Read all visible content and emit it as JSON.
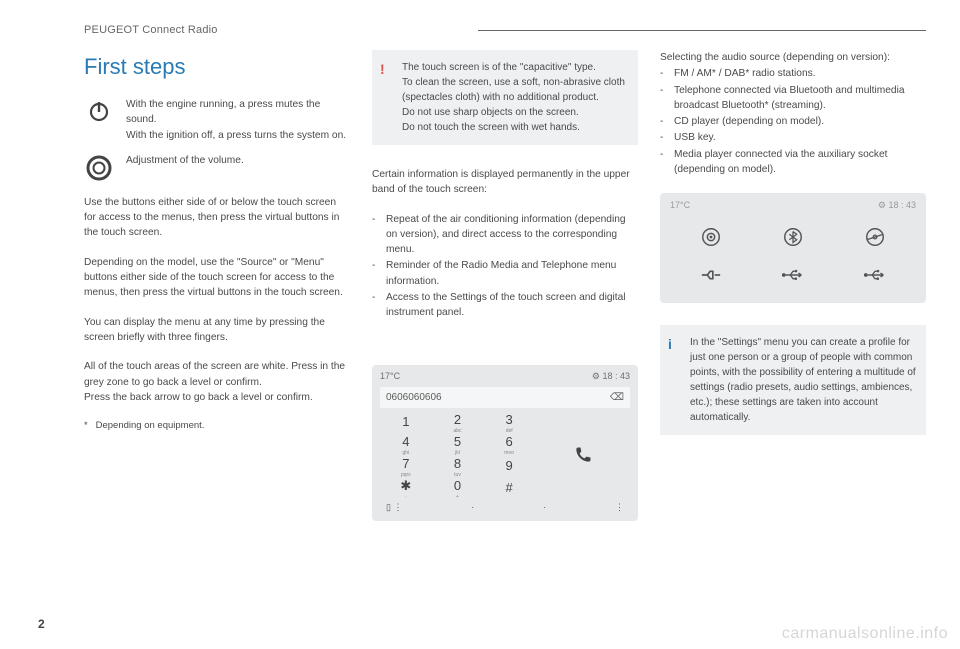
{
  "page_number": "2",
  "header": "PEUGEOT Connect Radio",
  "title": "First steps",
  "power_text": "With the engine running, a press mutes the sound.\nWith the ignition off, a press turns the system on.",
  "volume_text": "Adjustment of the volume.",
  "col1_p1": "Use the buttons either side of or below the touch screen for access to the menus, then press the virtual buttons in the touch screen.",
  "col1_p2": "Depending on the model, use the \"Source\" or \"Menu\" buttons either side of the touch screen for access to the menus, then press the virtual buttons in the touch screen.",
  "col1_p3": "You can display the menu at any time by pressing the screen briefly with three fingers.",
  "col1_p4": "All of the touch areas of the screen are white. Press in the grey zone to go back a level or confirm.\nPress the back arrow to go back a level or confirm.",
  "footnote_symbol": "*",
  "footnote_text": "Depending on equipment.",
  "warn_box": "The touch screen is of the \"capacitive\" type.\nTo clean the screen, use a soft, non-abrasive cloth (spectacles cloth) with no additional product.\nDo not use sharp objects on the screen.\nDo not touch the screen with wet hands.",
  "col2_intro": "Certain information is displayed permanently in the upper band of the touch screen:",
  "col2_bullets": [
    "Repeat of the air conditioning information (depending on version), and direct access to the corresponding menu.",
    "Reminder of the Radio Media and Telephone menu information.",
    "Access to the Settings of the touch screen and digital instrument panel."
  ],
  "phone_mock": {
    "temp": "17°C",
    "clock": "18 : 43",
    "dialed": "0606060606",
    "keys": [
      [
        "1",
        ""
      ],
      [
        "2",
        "abc"
      ],
      [
        "3",
        "def"
      ],
      [
        "4",
        "ghi"
      ],
      [
        "5",
        "jkl"
      ],
      [
        "6",
        "mno"
      ],
      [
        "7",
        "pqrs"
      ],
      [
        "8",
        "tuv"
      ],
      [
        "9",
        ""
      ],
      [
        "✱",
        "·"
      ],
      [
        "0",
        "+"
      ],
      [
        "#",
        ""
      ]
    ]
  },
  "col3_intro": "Selecting the audio source (depending on version):",
  "col3_bullets": [
    "FM / AM* / DAB* radio stations.",
    "Telephone connected via Bluetooth and multimedia broadcast Bluetooth* (streaming).",
    "CD player (depending on model).",
    "USB key.",
    "Media player connected via the auxiliary socket (depending on model)."
  ],
  "source_mock": {
    "temp": "17°C",
    "clock": "18 : 43"
  },
  "info_box": "In the \"Settings\" menu you can create a profile for just one person or a group of people with common points, with the possibility of entering a multitude of settings (radio presets, audio settings, ambiences, etc.); these settings are taken into account automatically.",
  "watermark": "carmanualsonline.info"
}
